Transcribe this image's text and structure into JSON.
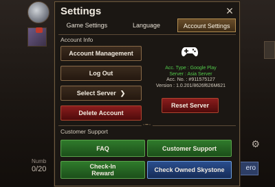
{
  "background": {
    "number_label": "Numb",
    "count": "0/20",
    "hero_label": "ero"
  },
  "settings": {
    "title": "Settings",
    "close_icon": "×",
    "tabs": [
      {
        "label": "Game Settings",
        "active": false
      },
      {
        "label": "Language",
        "active": false
      },
      {
        "label": "Account Settings",
        "active": true
      }
    ],
    "account_info": {
      "section_label": "Account Info",
      "account_management": "Account Management",
      "log_out": "Log Out",
      "select_server": "Select Server",
      "delete_account": "Delete Account",
      "reset_server": "Reset Server",
      "platform_icon": "gamepad-icon",
      "acc_type": "Acc. Type : Google Play",
      "server": "Server : Asia Server",
      "acc_no": "Acc. No. : #911575127",
      "version": "Version : 1.0.201/8626f626M621"
    },
    "customer_support": {
      "section_label": "Customer Support",
      "faq": "FAQ",
      "customer_support_btn": "Customer Support",
      "check_in_reward": "Check-In\nReward",
      "check_owned_skystone": "Check Owned Skystone"
    },
    "colors": {
      "accent_gold": "#b58f52",
      "green_text": "#52c94b",
      "red_button": "#8a1d1d",
      "green_button": "#2f7a2b",
      "blue_button": "#2a4e8e"
    }
  }
}
